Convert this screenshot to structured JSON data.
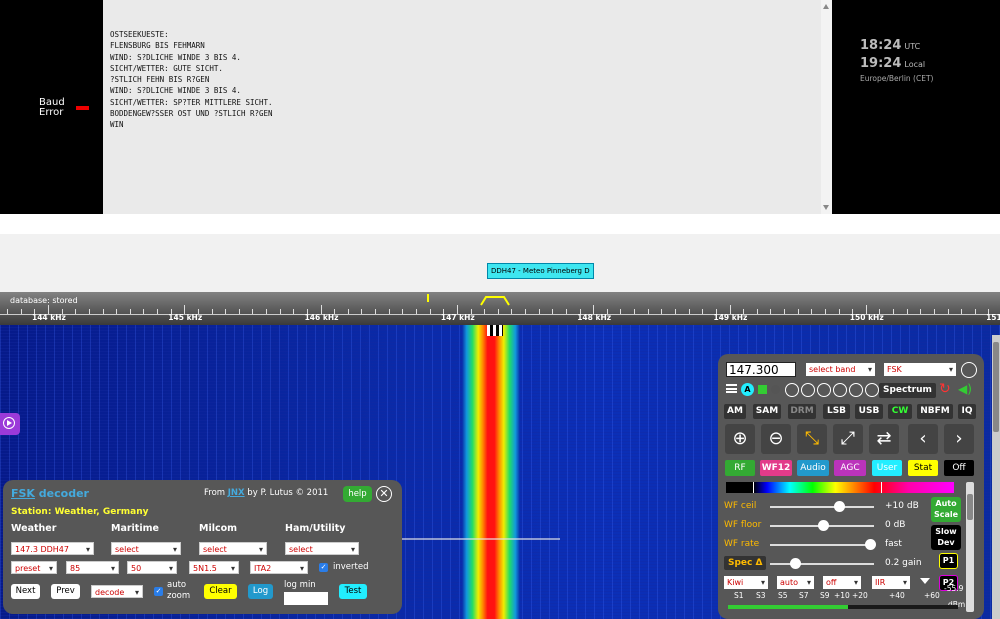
{
  "baud": {
    "label_line1": "Baud",
    "label_line2": "Error"
  },
  "console": {
    "lines": [
      "OSTSEEKUESTE:",
      "FLENSBURG BIS FEHMARN",
      "WIND: S?DLICHE WINDE 3 BIS 4.",
      "SICHT/WETTER: GUTE SICHT.",
      "?STLICH FEHN BIS R?GEN",
      "WIND: S?DLICHE WINDE 3 BIS 4.",
      "SICHT/WETTER: SP?TER MITTLERE SICHT.",
      "BODDENGEW?SSER OST UND ?STLICH R?GEN",
      "WIN"
    ]
  },
  "clock": {
    "utc_time": "18:24",
    "utc_label": "UTC",
    "local_time": "19:24",
    "local_label": "Local",
    "timezone": "Europe/Berlin (CET)"
  },
  "station_label": "DDH47 - Meteo Pinneberg D",
  "scale": {
    "database": "database: stored",
    "freq_labels": [
      "144 kHz",
      "145 kHz",
      "146 kHz",
      "147 kHz",
      "148 kHz",
      "149 kHz",
      "150 kHz",
      "151"
    ]
  },
  "fsk": {
    "title_short": "FSK",
    "title_rest": " decoder",
    "from_prefix": "From ",
    "from_link": "JNX",
    "from_suffix": " by P. Lutus © 2011",
    "help": "help",
    "close_glyph": "✕",
    "station": "Station: Weather, Germany",
    "headers": [
      "Weather",
      "Maritime",
      "Milcom",
      "Ham/Utility"
    ],
    "weather_select": "147.3 DDH47",
    "maritime_select": "select",
    "milcom_select": "select",
    "ham_select": "select",
    "preset": "preset",
    "shift": "85",
    "baud": "50",
    "framing": "5N1.5",
    "encoding": "ITA2",
    "inverted": "inverted",
    "next": "Next",
    "prev": "Prev",
    "mode": "decode",
    "auto": "auto",
    "zoom": "zoom",
    "clear": "Clear",
    "log": "Log",
    "log_min": "log min",
    "test": "Test"
  },
  "control": {
    "frequency": "147.300",
    "band": "select band",
    "ext": "FSK",
    "spectrum": "Spectrum",
    "modes": [
      "AM",
      "SAM",
      "DRM",
      "LSB",
      "USB",
      "CW",
      "NBFM",
      "IQ"
    ],
    "tabs": [
      "RF",
      "WF12",
      "Audio",
      "AGC",
      "User",
      "Stat",
      "Off"
    ],
    "wf_ceil_label": "WF ceil",
    "wf_ceil_value": "+10 dB",
    "wf_floor_label": "WF floor",
    "wf_floor_value": "0 dB",
    "wf_rate_label": "WF rate",
    "wf_rate_value": "fast",
    "spec_label": "Spec Δ",
    "spec_value": "0.2 gain",
    "auto_scale_1": "Auto",
    "auto_scale_2": "Scale",
    "slow_dev_1": "Slow",
    "slow_dev_2": "Dev",
    "p1": "P1",
    "p2": "P2",
    "bottom_selects": [
      "Kiwi",
      "auto",
      "off",
      "IIR"
    ],
    "smeter_labels": [
      "S1",
      "S3",
      "S5",
      "S7",
      "S9",
      "+10",
      "+20",
      "+40",
      "+60"
    ],
    "dbm_value": "-55.9",
    "dbm_unit": "dBm",
    "a_badge": "A"
  },
  "colors": {
    "accent_blue": "#44aadd",
    "signal_red": "#ff1111",
    "waterfall_blue": "#0a2aa8"
  }
}
